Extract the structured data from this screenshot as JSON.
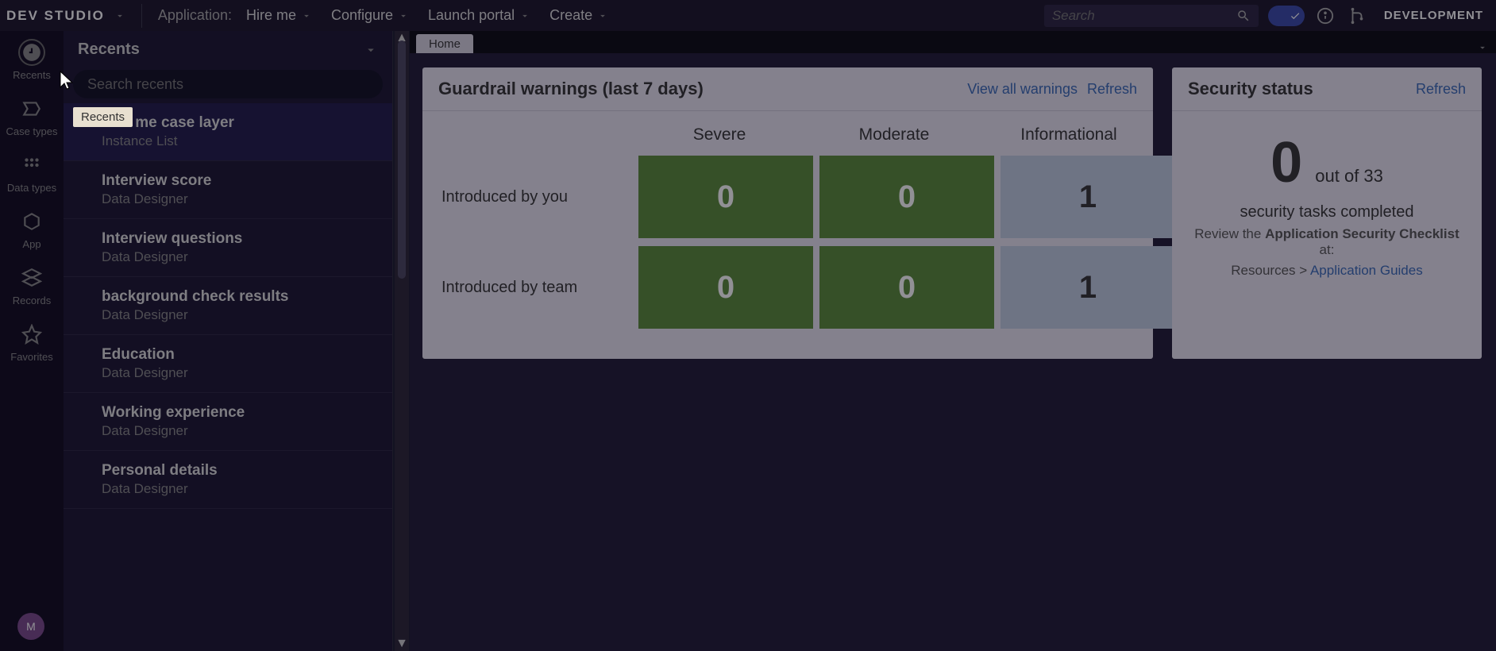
{
  "topbar": {
    "logo": "DEV STUDIO",
    "app_label": "Application:",
    "app_name": "Hire me",
    "menu_configure": "Configure",
    "menu_launch": "Launch portal",
    "menu_create": "Create",
    "search_placeholder": "Search",
    "env": "DEVELOPMENT"
  },
  "rail": {
    "recents": "Recents",
    "case_types": "Case types",
    "data_types": "Data types",
    "app": "App",
    "records": "Records",
    "favorites": "Favorites",
    "avatar": "M"
  },
  "panel": {
    "title": "Recents",
    "search_placeholder": "Search recents",
    "tooltip": "Recents",
    "items": [
      {
        "title": "Hire me case layer",
        "sub": "Instance List"
      },
      {
        "title": "Interview score",
        "sub": "Data Designer"
      },
      {
        "title": "Interview questions",
        "sub": "Data Designer"
      },
      {
        "title": "background check results",
        "sub": "Data Designer"
      },
      {
        "title": "Education",
        "sub": "Data Designer"
      },
      {
        "title": "Working experience",
        "sub": "Data Designer"
      },
      {
        "title": "Personal details",
        "sub": "Data Designer"
      }
    ]
  },
  "tab": {
    "home": "Home"
  },
  "guard": {
    "title": "Guardrail warnings (last 7 days)",
    "view_all": "View all warnings",
    "refresh": "Refresh",
    "col_severe": "Severe",
    "col_moderate": "Moderate",
    "col_info": "Informational",
    "row_you": "Introduced by you",
    "row_team": "Introduced by team",
    "you": {
      "severe": "0",
      "moderate": "0",
      "info": "1"
    },
    "team": {
      "severe": "0",
      "moderate": "0",
      "info": "1"
    }
  },
  "sec": {
    "title": "Security status",
    "refresh": "Refresh",
    "big_num": "0",
    "big_suffix": "out of 33",
    "completed": "security tasks completed",
    "review1": "Review the ",
    "review_bold": "Application Security Checklist",
    "review2": " at:",
    "path_prefix": "Resources > ",
    "path_link": "Application Guides"
  }
}
